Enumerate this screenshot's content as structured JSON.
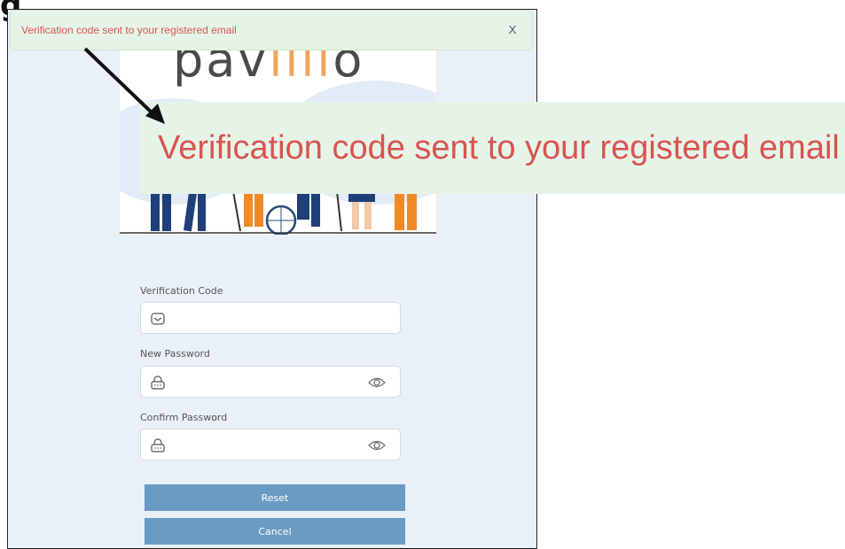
{
  "page": {
    "heading_fragment": "g"
  },
  "brand": {
    "logo_prefix": "pav",
    "logo_accent": "iiii",
    "logo_suffix": "o",
    "accent_color": "#f3a25b"
  },
  "toast": {
    "message": "Verification code sent to your registered email",
    "close_label": "X"
  },
  "zoom_callout": {
    "message": "Verification code sent to your registered email"
  },
  "form": {
    "verification_code": {
      "label": "Verification Code",
      "value": ""
    },
    "new_password": {
      "label": "New Password",
      "value": ""
    },
    "confirm_password": {
      "label": "Confirm Password",
      "value": ""
    }
  },
  "buttons": {
    "reset_label": "Reset",
    "cancel_label": "Cancel",
    "button_color": "#6a9bc3"
  },
  "icons": {
    "verification": "mail-icon",
    "password": "lock-icon",
    "reveal": "eye-icon",
    "close": "close-icon"
  }
}
